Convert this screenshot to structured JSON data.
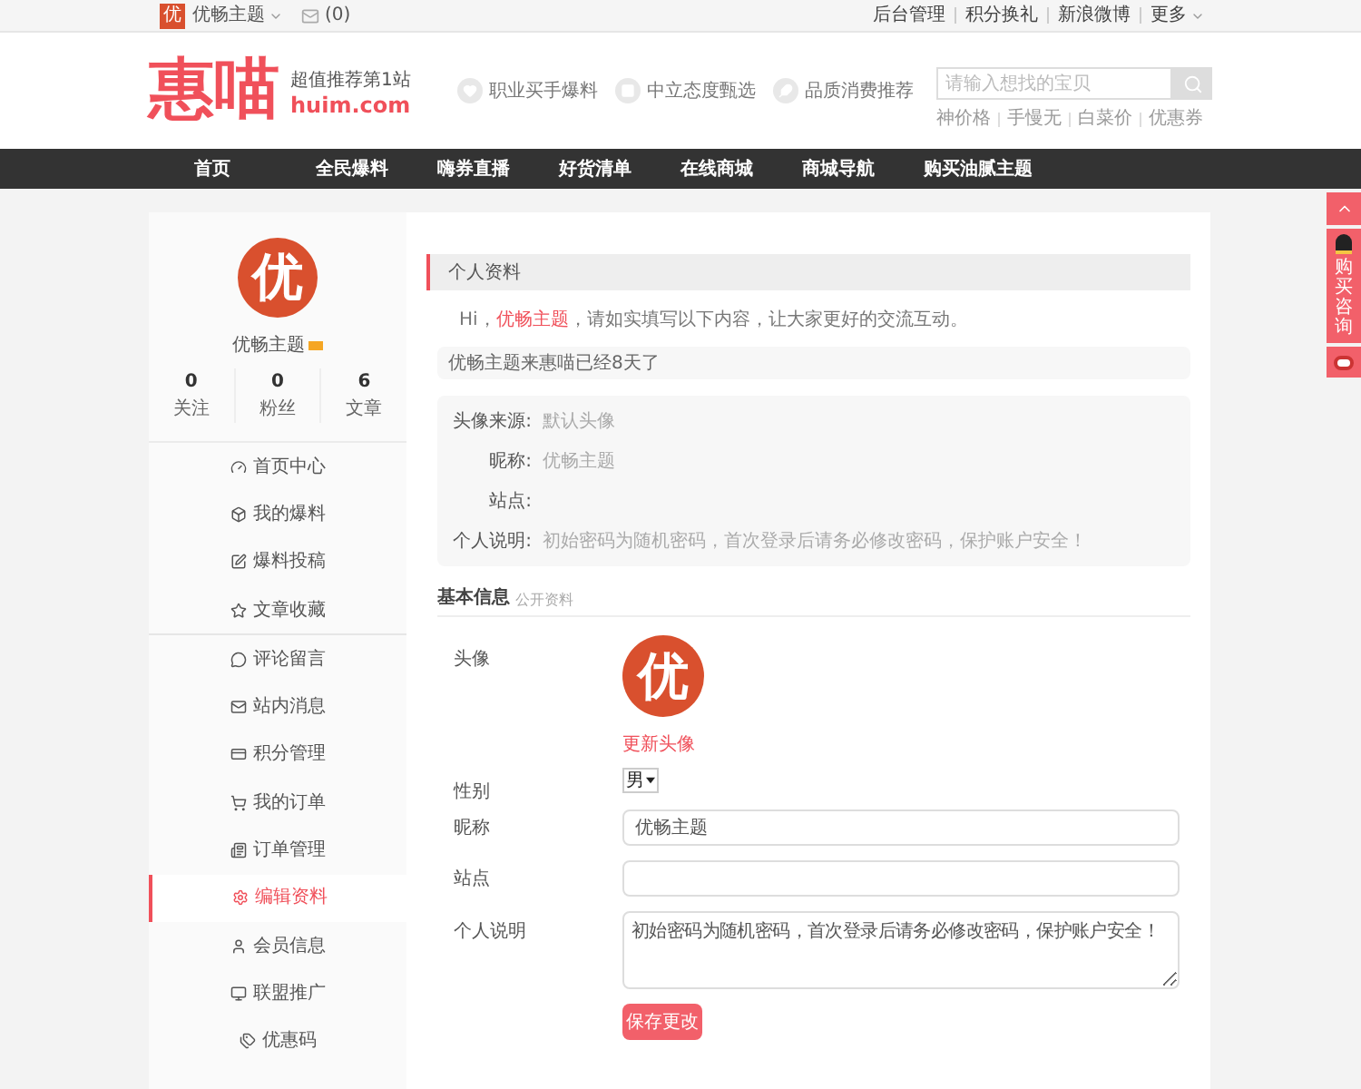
{
  "top_bar": {
    "logo_char": "优",
    "user": "优畅主题",
    "messages": "(0)",
    "links": [
      "后台管理",
      "积分换礼",
      "新浪微博",
      "更多"
    ]
  },
  "header": {
    "logo": "惠喵",
    "slogan": "超值推荐第1站",
    "domain": "huim.com",
    "features": [
      "职业买手爆料",
      "中立态度甄选",
      "品质消费推荐"
    ],
    "search": {
      "placeholder": "请输入想找的宝贝"
    },
    "hot": [
      "神价格",
      "手慢无",
      "白菜价",
      "优惠券"
    ]
  },
  "nav": [
    "首页",
    "全民爆料",
    "嗨券直播",
    "好货清单",
    "在线商城",
    "商城导航",
    "购买油腻主题"
  ],
  "sidebar": {
    "avatar_char": "优",
    "name": "优畅主题",
    "stats": [
      {
        "value": "0",
        "label": "关注"
      },
      {
        "value": "0",
        "label": "粉丝"
      },
      {
        "value": "6",
        "label": "文章"
      }
    ],
    "groups": [
      [
        {
          "label": "首页中心",
          "selected": false
        },
        {
          "label": "我的爆料",
          "selected": false
        },
        {
          "label": "爆料投稿",
          "selected": false
        },
        {
          "label": "文章收藏",
          "selected": false
        }
      ],
      [
        {
          "label": "评论留言",
          "selected": false
        },
        {
          "label": "站内消息",
          "selected": false
        },
        {
          "label": "积分管理",
          "selected": false
        },
        {
          "label": "我的订单",
          "selected": false
        },
        {
          "label": "订单管理",
          "selected": false
        },
        {
          "label": "编辑资料",
          "selected": true
        },
        {
          "label": "会员信息",
          "selected": false
        },
        {
          "label": "联盟推广",
          "selected": false
        },
        {
          "label": "优惠码",
          "selected": false
        }
      ]
    ]
  },
  "main": {
    "title": "个人资料",
    "greeting": {
      "prefix": "Hi，",
      "name": "优畅主题",
      "suffix": "，请如实填写以下内容，让大家更好的交流互动。"
    },
    "notice": "优畅主题来惠喵已经8天了",
    "details": [
      {
        "label": "头像来源:",
        "value": "默认头像"
      },
      {
        "label": "昵称:",
        "value": "优畅主题"
      },
      {
        "label": "站点:"
      },
      {
        "label": "个人说明:",
        "value": "初始密码为随机密码，首次登录后请务必修改密码，保护账户安全！"
      }
    ],
    "section": {
      "title": "基本信息",
      "subtitle": "公开资料"
    },
    "form": {
      "avatar_label": "头像",
      "avatar_char": "优",
      "avatar_link": "更新头像",
      "gender_label": "性别",
      "gender": "男",
      "nickname_label": "昵称",
      "nickname": "优畅主题",
      "site_label": "站点",
      "bio_label": "个人说明",
      "bio": "初始密码为随机密码，首次登录后请务必修改密码，保护账户安全！",
      "save": "保存更改"
    }
  },
  "float_bar": {
    "contact": "购买咨询"
  }
}
